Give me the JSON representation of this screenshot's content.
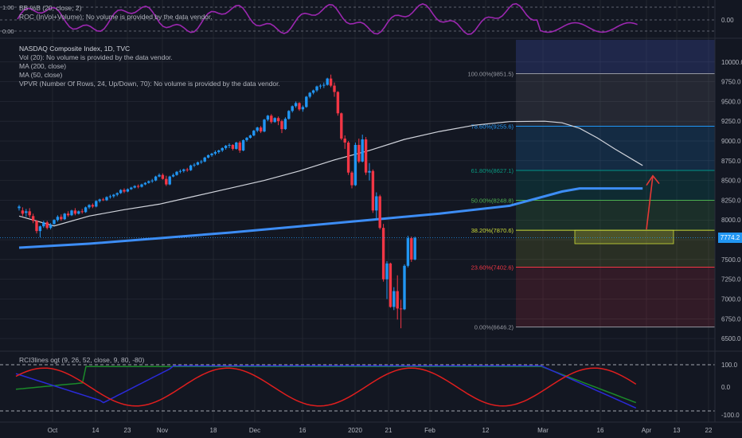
{
  "colors": {
    "background": "#131722",
    "grid": "#2a2e39",
    "up": "#2196f3",
    "down": "#f23645",
    "ma50": "#d1d4dc",
    "ma200": "#3d8df5",
    "bb": "#9c27b0",
    "rci_red": "#e01e1e",
    "rci_green": "#1b8a2a",
    "rci_blue": "#2a2ad8",
    "arrow": "#e53935",
    "last_price": "#2196f3"
  },
  "top_panel": {
    "legend": [
      "BB %B (20, close, 2)",
      "ROC (InVol+Volume): No volume is provided by the data vendor."
    ],
    "left_ticks": [
      "1.00",
      "0.00"
    ],
    "right_ticks": [
      "0.00"
    ]
  },
  "main_panel": {
    "legend": [
      "NASDAQ Composite Index, 1D, TVC",
      "Vol (20): No volume is provided by the data vendor.",
      "MA (200, close)",
      "MA (50, close)",
      "VPVR (Number Of Rows, 24, Up/Down, 70): No volume is provided by the data vendor."
    ],
    "last_price_label": "7774.2"
  },
  "bottom_panel": {
    "legend": "RCI3lines ogt (9, 26, 52, close, 9, 80, -80)",
    "right_ticks": [
      "100.0",
      "0.0",
      "-100.0"
    ]
  },
  "x_axis_labels": [
    "Oct",
    "14",
    "23",
    "Nov",
    "18",
    "Dec",
    "16",
    "2020",
    "21",
    "Feb",
    "12",
    "Mar",
    "16",
    "Apr",
    "13",
    "22"
  ],
  "chart_data": {
    "type": "candlestick",
    "title": "NASDAQ Composite Index, 1D, TVC",
    "y_axis_ticks": [
      10000,
      9750,
      9500,
      9250,
      9000,
      8750,
      8500,
      8250,
      8000,
      7750,
      7500,
      7250,
      7000,
      6750,
      6500
    ],
    "ylim": [
      6380,
      10280
    ],
    "last_price": 7774.2,
    "candles_ohlc": [
      [
        8150,
        8190,
        8120,
        8170
      ],
      [
        8120,
        8160,
        8050,
        8080
      ],
      [
        8090,
        8140,
        8040,
        8110
      ],
      [
        8110,
        8150,
        8030,
        8060
      ],
      [
        8050,
        8080,
        7960,
        7990
      ],
      [
        7990,
        8000,
        7830,
        7860
      ],
      [
        7860,
        7930,
        7780,
        7920
      ],
      [
        7920,
        7990,
        7900,
        7970
      ],
      [
        7970,
        7990,
        7880,
        7900
      ],
      [
        7900,
        7960,
        7880,
        7940
      ],
      [
        7950,
        8010,
        7940,
        8000
      ],
      [
        8000,
        8060,
        7980,
        8040
      ],
      [
        8040,
        8070,
        7990,
        8010
      ],
      [
        8010,
        8090,
        8000,
        8080
      ],
      [
        8080,
        8110,
        8040,
        8060
      ],
      [
        8060,
        8130,
        8050,
        8120
      ],
      [
        8120,
        8150,
        8060,
        8080
      ],
      [
        8080,
        8120,
        8070,
        8110
      ],
      [
        8110,
        8140,
        8080,
        8100
      ],
      [
        8100,
        8170,
        8090,
        8160
      ],
      [
        8160,
        8200,
        8140,
        8190
      ],
      [
        8190,
        8210,
        8150,
        8170
      ],
      [
        8170,
        8250,
        8160,
        8240
      ],
      [
        8240,
        8270,
        8220,
        8260
      ],
      [
        8260,
        8280,
        8240,
        8250
      ],
      [
        8250,
        8300,
        8240,
        8290
      ],
      [
        8290,
        8320,
        8270,
        8300
      ],
      [
        8300,
        8330,
        8280,
        8320
      ],
      [
        8320,
        8350,
        8300,
        8340
      ],
      [
        8340,
        8390,
        8330,
        8380
      ],
      [
        8380,
        8400,
        8340,
        8360
      ],
      [
        8360,
        8400,
        8350,
        8390
      ],
      [
        8390,
        8420,
        8380,
        8410
      ],
      [
        8410,
        8440,
        8400,
        8430
      ],
      [
        8430,
        8450,
        8400,
        8420
      ],
      [
        8420,
        8460,
        8410,
        8450
      ],
      [
        8450,
        8480,
        8440,
        8470
      ],
      [
        8470,
        8500,
        8460,
        8490
      ],
      [
        8490,
        8520,
        8470,
        8500
      ],
      [
        8500,
        8560,
        8490,
        8550
      ],
      [
        8550,
        8590,
        8540,
        8570
      ],
      [
        8570,
        8590,
        8510,
        8520
      ],
      [
        8520,
        8560,
        8430,
        8450
      ],
      [
        8450,
        8560,
        8440,
        8550
      ],
      [
        8550,
        8590,
        8540,
        8570
      ],
      [
        8570,
        8620,
        8560,
        8610
      ],
      [
        8610,
        8640,
        8590,
        8620
      ],
      [
        8620,
        8650,
        8600,
        8640
      ],
      [
        8640,
        8660,
        8610,
        8630
      ],
      [
        8630,
        8700,
        8620,
        8690
      ],
      [
        8690,
        8720,
        8670,
        8700
      ],
      [
        8700,
        8740,
        8690,
        8730
      ],
      [
        8730,
        8760,
        8710,
        8740
      ],
      [
        8740,
        8800,
        8730,
        8790
      ],
      [
        8790,
        8830,
        8780,
        8820
      ],
      [
        8820,
        8850,
        8800,
        8840
      ],
      [
        8840,
        8880,
        8820,
        8860
      ],
      [
        8860,
        8890,
        8840,
        8880
      ],
      [
        8880,
        8920,
        8860,
        8910
      ],
      [
        8910,
        8950,
        8890,
        8940
      ],
      [
        8940,
        8970,
        8910,
        8950
      ],
      [
        8950,
        8960,
        8880,
        8900
      ],
      [
        8900,
        8990,
        8890,
        8980
      ],
      [
        8980,
        9000,
        8850,
        8880
      ],
      [
        8880,
        9020,
        8870,
        9010
      ],
      [
        9010,
        9050,
        8990,
        9040
      ],
      [
        9040,
        9080,
        9030,
        9070
      ],
      [
        9070,
        9140,
        9060,
        9130
      ],
      [
        9130,
        9180,
        9110,
        9170
      ],
      [
        9170,
        9190,
        9100,
        9120
      ],
      [
        9120,
        9280,
        9110,
        9270
      ],
      [
        9270,
        9330,
        9250,
        9320
      ],
      [
        9320,
        9340,
        9220,
        9240
      ],
      [
        9240,
        9300,
        9230,
        9290
      ],
      [
        9290,
        9310,
        9200,
        9250
      ],
      [
        9250,
        9270,
        9100,
        9150
      ],
      [
        9150,
        9300,
        9140,
        9280
      ],
      [
        9280,
        9390,
        9270,
        9380
      ],
      [
        9380,
        9450,
        9360,
        9440
      ],
      [
        9440,
        9500,
        9420,
        9480
      ],
      [
        9480,
        9490,
        9380,
        9400
      ],
      [
        9400,
        9450,
        9370,
        9430
      ],
      [
        9430,
        9570,
        9420,
        9560
      ],
      [
        9560,
        9620,
        9540,
        9610
      ],
      [
        9610,
        9650,
        9590,
        9640
      ],
      [
        9640,
        9700,
        9620,
        9690
      ],
      [
        9690,
        9720,
        9660,
        9700
      ],
      [
        9700,
        9740,
        9670,
        9710
      ],
      [
        9710,
        9800,
        9700,
        9790
      ],
      [
        9790,
        9840,
        9680,
        9700
      ],
      [
        9700,
        9740,
        9560,
        9620
      ],
      [
        9620,
        9630,
        9320,
        9350
      ],
      [
        9350,
        9360,
        9010,
        9030
      ],
      [
        9030,
        9070,
        8900,
        8980
      ],
      [
        8980,
        9000,
        8570,
        8600
      ],
      [
        8600,
        8620,
        8400,
        8440
      ],
      [
        8440,
        8980,
        8430,
        8950
      ],
      [
        8950,
        9030,
        8720,
        8740
      ],
      [
        8740,
        9080,
        8730,
        9020
      ],
      [
        9020,
        9050,
        8570,
        8600
      ],
      [
        8600,
        8720,
        8500,
        8620
      ],
      [
        8620,
        8640,
        8090,
        8120
      ],
      [
        8120,
        8350,
        8000,
        8300
      ],
      [
        8300,
        8320,
        7880,
        7900
      ],
      [
        7900,
        7950,
        7220,
        7250
      ],
      [
        7250,
        7480,
        7000,
        7450
      ],
      [
        7450,
        7460,
        6890,
        6900
      ],
      [
        6900,
        7150,
        6860,
        7100
      ],
      [
        7100,
        7300,
        6740,
        6880
      ],
      [
        6880,
        6990,
        6630,
        6870
      ],
      [
        6870,
        7440,
        6860,
        7420
      ],
      [
        7420,
        7800,
        7400,
        7770
      ],
      [
        7770,
        7790,
        7470,
        7500
      ],
      [
        7500,
        7790,
        7490,
        7774
      ]
    ],
    "ma50": [
      [
        0,
        8050
      ],
      [
        10,
        7925
      ],
      [
        20,
        8050
      ],
      [
        30,
        8130
      ],
      [
        40,
        8200
      ],
      [
        50,
        8300
      ],
      [
        60,
        8400
      ],
      [
        70,
        8500
      ],
      [
        80,
        8620
      ],
      [
        90,
        8760
      ],
      [
        100,
        8880
      ],
      [
        110,
        9020
      ],
      [
        120,
        9120
      ],
      [
        130,
        9200
      ],
      [
        140,
        9245
      ],
      [
        150,
        9250
      ],
      [
        155,
        9230
      ],
      [
        160,
        9160
      ],
      [
        165,
        9040
      ],
      [
        170,
        8900
      ],
      [
        178,
        8690
      ]
    ],
    "ma200": [
      [
        0,
        7650
      ],
      [
        20,
        7700
      ],
      [
        40,
        7770
      ],
      [
        60,
        7840
      ],
      [
        80,
        7920
      ],
      [
        100,
        8000
      ],
      [
        120,
        8080
      ],
      [
        140,
        8180
      ],
      [
        150,
        8300
      ],
      [
        155,
        8360
      ],
      [
        160,
        8400
      ],
      [
        170,
        8400
      ],
      [
        178,
        8400
      ]
    ],
    "fibonacci": [
      {
        "label": "100.00%(9851.5)",
        "value": 9851.5
      },
      {
        "label": "78.60%(9255.6)",
        "value": 9186.6
      },
      {
        "label": "61.80%(8627.1)",
        "value": 8627.1
      },
      {
        "label": "50.00%(8248.8)",
        "value": 8248.8
      },
      {
        "label": "38.20%(7870.6)",
        "value": 7870.6
      },
      {
        "label": "23.60%(7402.6)",
        "value": 7402.6
      },
      {
        "label": "0.00%(6646.2)",
        "value": 6646.2
      }
    ],
    "zone_box": {
      "y_top": 7870,
      "y_bottom": 7700
    },
    "arrow": {
      "from_y": 7880,
      "to_y": 8560
    }
  }
}
